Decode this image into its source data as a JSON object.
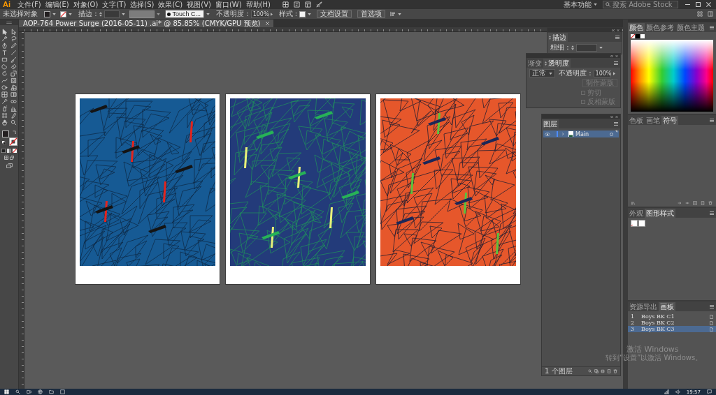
{
  "app": {
    "logo": "Ai"
  },
  "menu": [
    "文件(F)",
    "编辑(E)",
    "对象(O)",
    "文字(T)",
    "选择(S)",
    "效果(C)",
    "视图(V)",
    "窗口(W)",
    "帮助(H)"
  ],
  "workspace": {
    "label": "基本功能"
  },
  "stock_search": {
    "placeholder": "搜索 Adobe Stock"
  },
  "control_bar": {
    "selection": "未选择对象",
    "stroke_label": "描边 :",
    "brush": "Touch C...",
    "opacity_label": "不透明度 :",
    "opacity": "100%",
    "style_label": "样式 :",
    "buttons": [
      "文档设置",
      "首选项"
    ]
  },
  "document_tabs": [
    {
      "title": "AOP-764 Power Surge (2016-05-11) .ai* @ 85.85% (CMYK/GPU 预览)",
      "selected": true
    }
  ],
  "artboards": [
    {
      "color": "#165a94"
    },
    {
      "color": "#233b7a"
    },
    {
      "color": "#e6572b"
    }
  ],
  "stroke_panel": {
    "title": "描边",
    "weight_label": "粗细 :"
  },
  "transparency_panel": {
    "tabs": [
      {
        "label": "渐变",
        "selected": false
      },
      {
        "label": "透明度",
        "selected": true
      }
    ],
    "blend_mode": "正常",
    "opacity_label": "不透明度 :",
    "opacity": "100%",
    "mask_button": {
      "label": "制作蒙版",
      "disabled": true
    },
    "options": [
      {
        "label": "剪切",
        "checked": false,
        "disabled": true
      },
      {
        "label": "反相蒙版",
        "checked": false,
        "disabled": true
      }
    ]
  },
  "layers_panel": {
    "tabs": [
      {
        "label": "图层",
        "selected": true
      }
    ],
    "layers": [
      {
        "name": "Main",
        "visible": true,
        "expanded": false,
        "selected": true
      }
    ],
    "footer": "1 个图层"
  },
  "color_panel": {
    "tabs": [
      {
        "label": "颜色",
        "selected": true
      },
      {
        "label": "颜色参考",
        "selected": false
      },
      {
        "label": "颜色主题",
        "selected": false
      }
    ]
  },
  "symbols_panel": {
    "tabs": [
      {
        "label": "色板",
        "selected": false
      },
      {
        "label": "画笔",
        "selected": false
      },
      {
        "label": "符号",
        "selected": true
      }
    ]
  },
  "styles_panel": {
    "tabs": [
      {
        "label": "外观",
        "selected": false
      },
      {
        "label": "图形样式",
        "selected": true
      }
    ]
  },
  "artboards_panel": {
    "tabs": [
      {
        "label": "资源导出",
        "selected": false
      },
      {
        "label": "画板",
        "selected": true
      }
    ],
    "items": [
      {
        "number": "1",
        "name": "Boys BK C1",
        "selected": false
      },
      {
        "number": "2",
        "name": "Boys BK C2",
        "selected": false
      },
      {
        "number": "3",
        "name": "Boys BK C3",
        "selected": true
      }
    ]
  },
  "activation": {
    "title": "激活 Windows",
    "text": "转到“设置”以激活 Windows。"
  },
  "taskbar": {
    "time": "19:57"
  }
}
